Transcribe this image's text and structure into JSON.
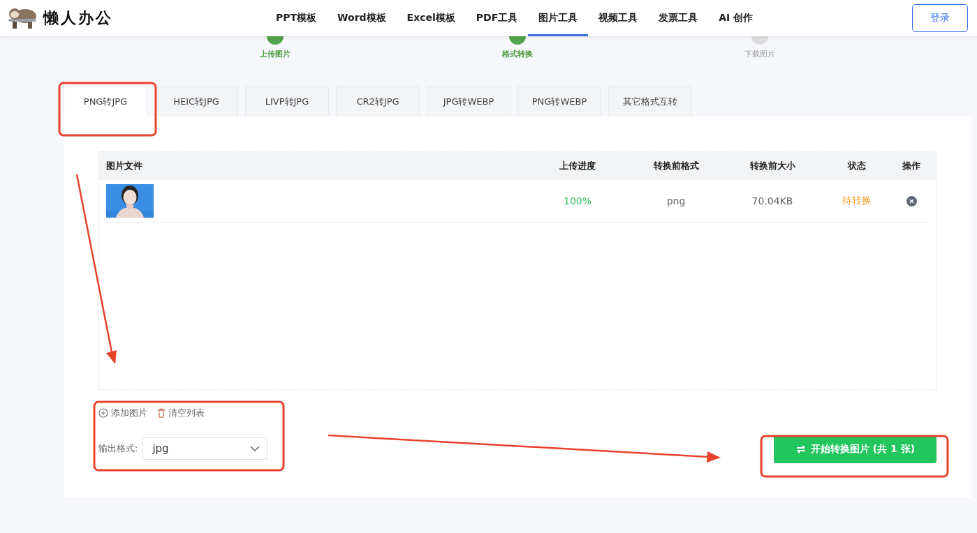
{
  "header": {
    "logo_text": "懒人办公",
    "nav": [
      {
        "label": "PPT模板",
        "selected": false
      },
      {
        "label": "Word模板",
        "selected": false
      },
      {
        "label": "Excel模板",
        "selected": false
      },
      {
        "label": "PDF工具",
        "selected": false
      },
      {
        "label": "图片工具",
        "selected": true
      },
      {
        "label": "视频工具",
        "selected": false
      },
      {
        "label": "发票工具",
        "selected": false
      },
      {
        "label": "AI 创作",
        "selected": false
      }
    ],
    "login": "登录"
  },
  "steps": [
    {
      "label": "上传图片",
      "completed": true
    },
    {
      "label": "格式转换",
      "completed": true
    },
    {
      "label": "下载图片",
      "completed": false
    }
  ],
  "tabs": [
    {
      "label": "PNG转JPG",
      "selected": true
    },
    {
      "label": "HEIC转JPG",
      "selected": false
    },
    {
      "label": "LIVP转JPG",
      "selected": false
    },
    {
      "label": "CR2转JPG",
      "selected": false
    },
    {
      "label": "JPG转WEBP",
      "selected": false
    },
    {
      "label": "PNG转WEBP",
      "selected": false
    },
    {
      "label": "其它格式互转",
      "selected": false
    }
  ],
  "table": {
    "columns": [
      "图片文件",
      "上传进度",
      "转换前格式",
      "转换前大小",
      "状态",
      "操作"
    ],
    "rows": [
      {
        "progress": "100%",
        "format": "png",
        "size": "70.04KB",
        "status": "待转换"
      }
    ]
  },
  "actions": [
    {
      "kind": "add",
      "label": "添加图片"
    },
    {
      "kind": "clear",
      "label": "清空列表"
    }
  ],
  "output_format": {
    "label": "输出格式:",
    "value": "jpg"
  },
  "convert_button": "开始转换图片 (共 1 张)",
  "annotations": [
    {
      "kind": "box"
    },
    {
      "kind": "box"
    },
    {
      "kind": "box"
    },
    {
      "kind": "arrow"
    },
    {
      "kind": "arrow"
    }
  ]
}
